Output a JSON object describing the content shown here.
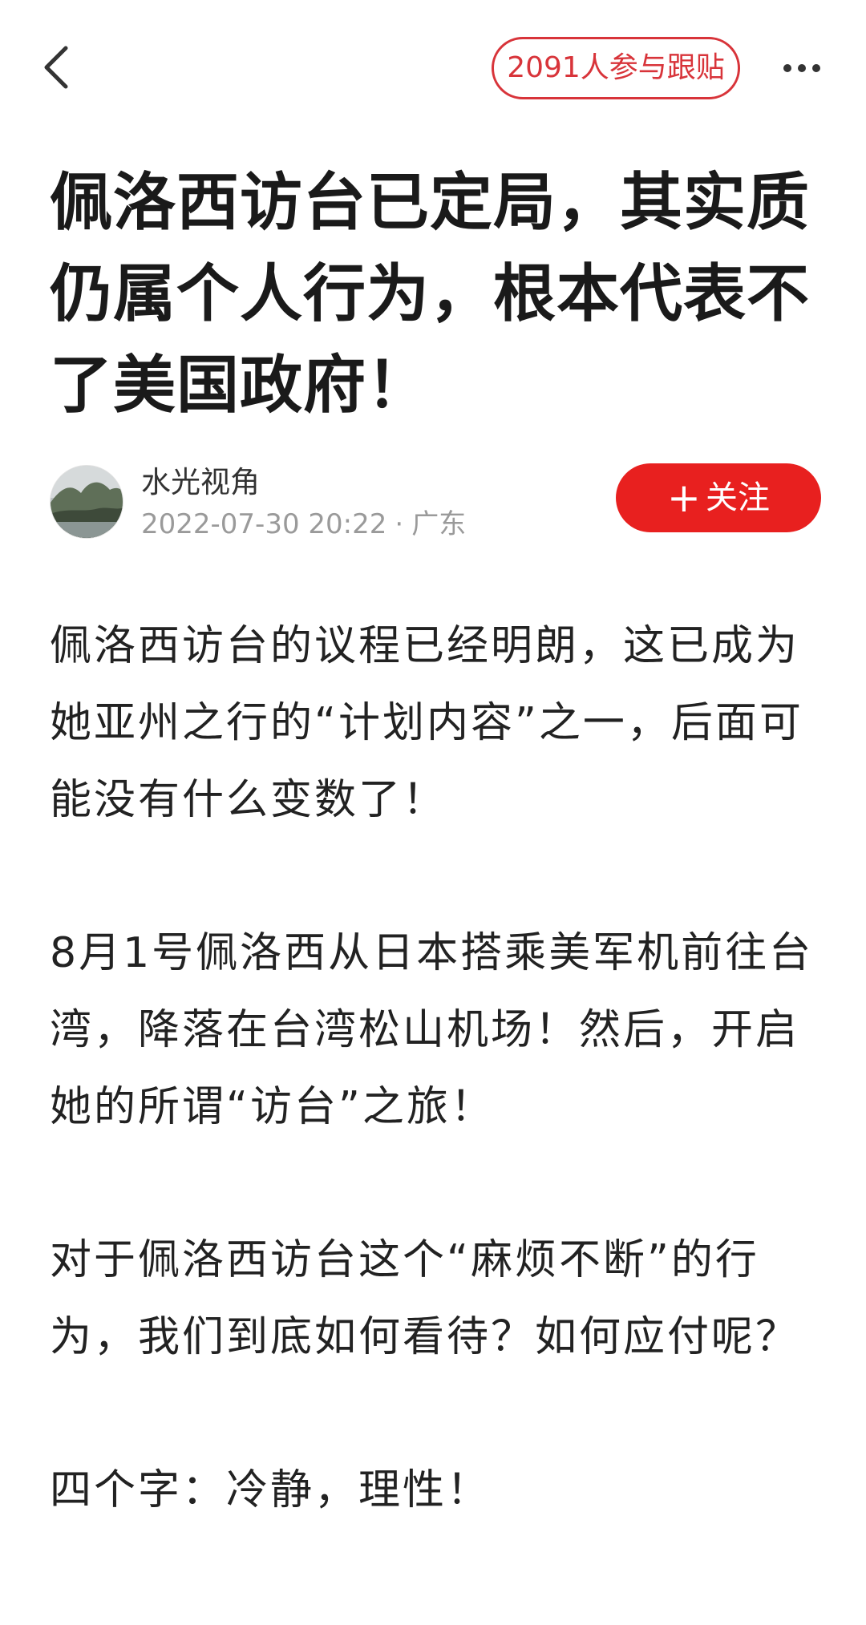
{
  "header": {
    "back_icon": "chevron-left-icon",
    "comments_label": "2091人参与跟贴",
    "more_icon": "more-horizontal-icon",
    "accent_color": "#d8343a"
  },
  "article": {
    "title": "佩洛西访台已定局，其实质仍属个人行为，根本代表不了美国政府！",
    "author": {
      "name": "水光视角",
      "date": "2022-07-30 20:22",
      "location_sep": "·",
      "location": "广东",
      "follow_label": "关注",
      "follow_icon": "plus-icon",
      "follow_color": "#e8201f"
    },
    "paragraphs": [
      "佩洛西访台的议程已经明朗，这已成为她亚州之行的“计划内容”之一，后面可能没有什么变数了！",
      "8月1号佩洛西从日本搭乘美军机前往台湾，降落在台湾松山机场！然后，开启她的所谓“访台”之旅！",
      "对于佩洛西访台这个“麻烦不断”的行为，我们到底如何看待？如何应付呢？",
      "四个字：冷静，理性！"
    ]
  }
}
